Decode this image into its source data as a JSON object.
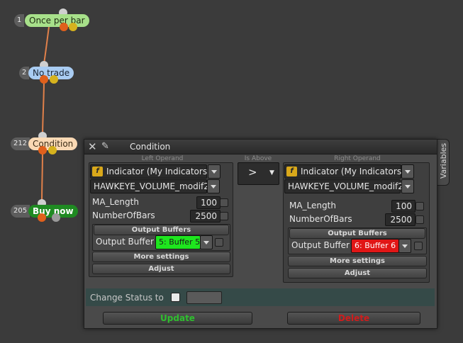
{
  "nodes": [
    {
      "id": "1",
      "label": "Once per bar",
      "color": "#a7e08a"
    },
    {
      "id": "2",
      "label": "No trade",
      "color": "#a9ccf2"
    },
    {
      "id": "212",
      "label": "Condition",
      "color": "#fad9b4"
    },
    {
      "id": "205",
      "label": "Buy now",
      "color": "#1f8a22"
    }
  ],
  "dialog": {
    "title": "Condition",
    "side_tab": "Variables",
    "left_caption": "Left Operand",
    "operator_caption": "Is Above",
    "right_caption": "Right Operand",
    "operator": ">",
    "left": {
      "source": "Indicator (My Indicators)",
      "indicator": "HAWKEYE_VOLUME_modif2",
      "params": [
        {
          "name": "MA_Length",
          "value": "100"
        },
        {
          "name": "NumberOfBars",
          "value": "2500"
        }
      ],
      "output_buffers_label": "Output Buffers",
      "output_buffer_label": "Output Buffer",
      "buffer_value": "5: Buffer 5",
      "buffer_color": "#1ee61e",
      "more_settings": "More settings",
      "adjust": "Adjust"
    },
    "right": {
      "source": "Indicator (My Indicators)",
      "indicator": "HAWKEYE_VOLUME_modif2",
      "params": [
        {
          "name": "MA_Length",
          "value": "100"
        },
        {
          "name": "NumberOfBars",
          "value": "2500"
        }
      ],
      "output_buffers_label": "Output Buffers",
      "output_buffer_label": "Output Buffer",
      "buffer_value": "6: Buffer 6",
      "buffer_color": "#e11616",
      "more_settings": "More settings",
      "adjust": "Adjust"
    },
    "change_status_label": "Change Status to",
    "update": "Update",
    "delete": "Delete"
  },
  "colors": {
    "update_text": "#2fbf2f",
    "delete_text": "#d01c1c",
    "link": "#e0804a"
  },
  "icons": {
    "close": "close-icon",
    "pin": "pin-icon",
    "function": "function-icon"
  }
}
